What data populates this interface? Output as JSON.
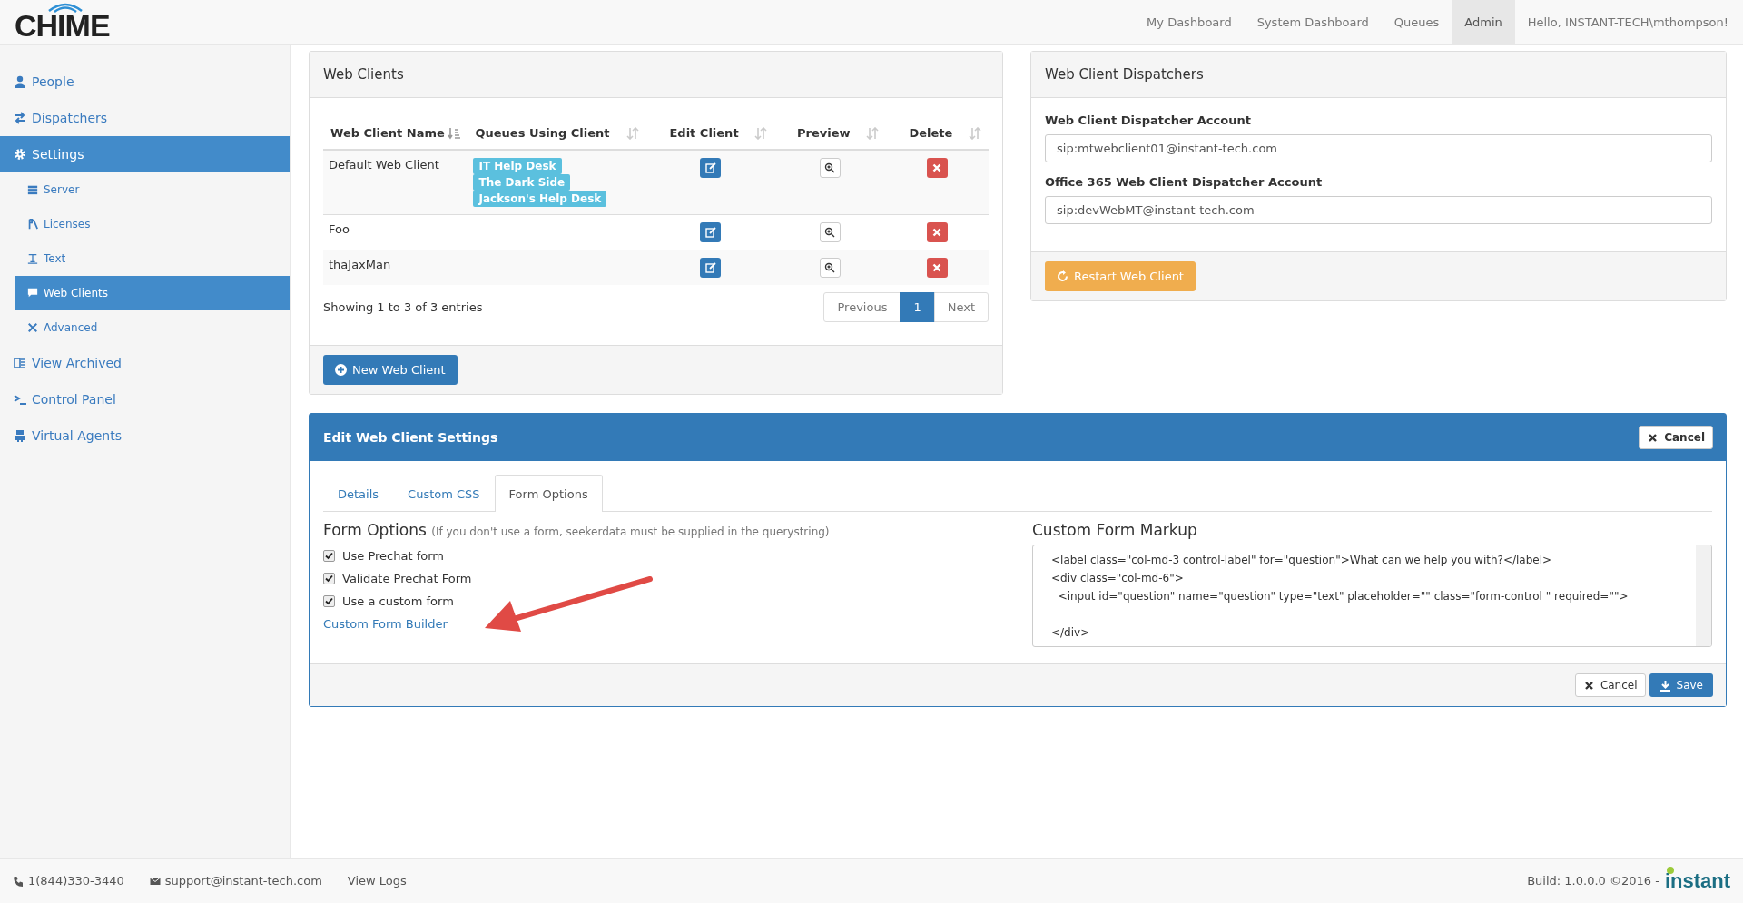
{
  "header": {
    "logo": "CHIME",
    "nav": [
      {
        "label": "My Dashboard",
        "selected": false
      },
      {
        "label": "System Dashboard",
        "selected": false
      },
      {
        "label": "Queues",
        "selected": false
      },
      {
        "label": "Admin",
        "selected": true
      }
    ],
    "greeting": "Hello, INSTANT-TECH\\mthompson!"
  },
  "sidebar": {
    "items": [
      {
        "label": "People",
        "selected": false
      },
      {
        "label": "Dispatchers",
        "selected": false
      },
      {
        "label": "Settings",
        "selected": true,
        "children": [
          {
            "label": "Server",
            "selected": false
          },
          {
            "label": "Licenses",
            "selected": false
          },
          {
            "label": "Text",
            "selected": false
          },
          {
            "label": "Web Clients",
            "selected": true
          },
          {
            "label": "Advanced",
            "selected": false
          }
        ]
      },
      {
        "label": "View Archived",
        "selected": false
      },
      {
        "label": "Control Panel",
        "selected": false
      },
      {
        "label": "Virtual Agents",
        "selected": false
      }
    ]
  },
  "web_clients": {
    "title": "Web Clients",
    "columns": [
      {
        "label": "Web Client Name",
        "sorted": true
      },
      {
        "label": "Queues Using Client",
        "sorted": false
      },
      {
        "label": "Edit Client",
        "sorted": false
      },
      {
        "label": "Preview",
        "sorted": false
      },
      {
        "label": "Delete",
        "sorted": false
      }
    ],
    "rows": [
      {
        "name": "Default Web Client",
        "queues": [
          "IT Help Desk",
          "The Dark Side",
          "Jackson's Help Desk"
        ]
      },
      {
        "name": "Foo",
        "queues": []
      },
      {
        "name": "thaJaxMan",
        "queues": []
      }
    ],
    "info": "Showing 1 to 3 of 3 entries",
    "pagination": [
      {
        "label": "Previous",
        "selected": false
      },
      {
        "label": "1",
        "selected": true
      },
      {
        "label": "Next",
        "selected": false
      }
    ],
    "new_button": "New Web Client"
  },
  "dispatchers": {
    "title": "Web Client Dispatchers",
    "fields": [
      {
        "label": "Web Client Dispatcher Account",
        "value": "sip:mtwebclient01@instant-tech.com"
      },
      {
        "label": "Office 365 Web Client Dispatcher Account",
        "value": "sip:devWebMT@instant-tech.com"
      }
    ],
    "button": "Restart Web Client"
  },
  "edit": {
    "title": "Edit Web Client Settings",
    "cancel": "Cancel",
    "tabs": [
      {
        "label": "Details",
        "selected": false
      },
      {
        "label": "Custom CSS",
        "selected": false
      },
      {
        "label": "Form Options",
        "selected": true
      }
    ],
    "form_options": {
      "heading": "Form Options",
      "note": "(If you don't use a form, seekerdata must be supplied in the querystring)",
      "options": [
        {
          "label": "Use Prechat form",
          "checked": true
        },
        {
          "label": "Validate Prechat Form",
          "checked": true
        },
        {
          "label": "Use a custom form",
          "checked": true
        }
      ],
      "link": "Custom Form Builder"
    },
    "markup": {
      "heading": "Custom Form Markup",
      "value": "<label class=\"col-md-3 control-label\" for=\"question\">What can we help you with?</label>\n<div class=\"col-md-6\">\n  <input id=\"question\" name=\"question\" type=\"text\" placeholder=\"\" class=\"form-control \" required=\"\">\n\n</div>"
    },
    "footer_cancel": "Cancel",
    "save": "Save"
  },
  "footer": {
    "phone": "1(844)330-3440",
    "email": "support@instant-tech.com",
    "logs": "View Logs",
    "build": "Build: 1.0.0.0 ©2016 -",
    "brand": "instant"
  }
}
